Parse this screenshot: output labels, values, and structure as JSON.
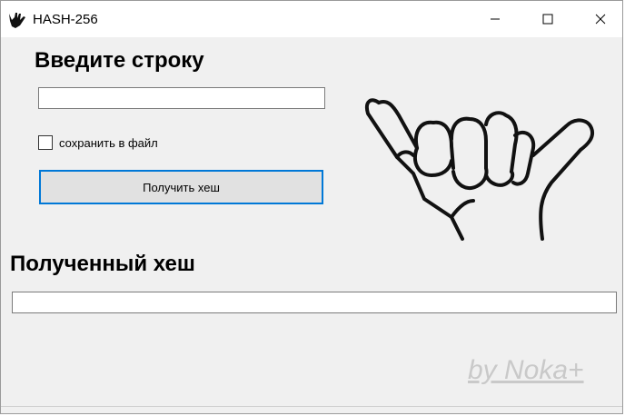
{
  "window": {
    "title": "HASH-256",
    "app_icon": "hand-shaka-icon",
    "controls": [
      "minimize-icon",
      "maximize-icon",
      "close-icon"
    ]
  },
  "input_section": {
    "heading": "Введите строку",
    "input_value": "",
    "checkbox_label": "сохранить в файл",
    "checkbox_checked": false,
    "button_label": "Получить хеш"
  },
  "output_section": {
    "heading": "Полученный хеш",
    "output_value": ""
  },
  "footer": {
    "signature": "by Noka+"
  },
  "colors": {
    "window_bg": "#f0f0f0",
    "titlebar_bg": "#ffffff",
    "button_border_accent": "#0078d7",
    "signature": "#c9c9c9"
  }
}
